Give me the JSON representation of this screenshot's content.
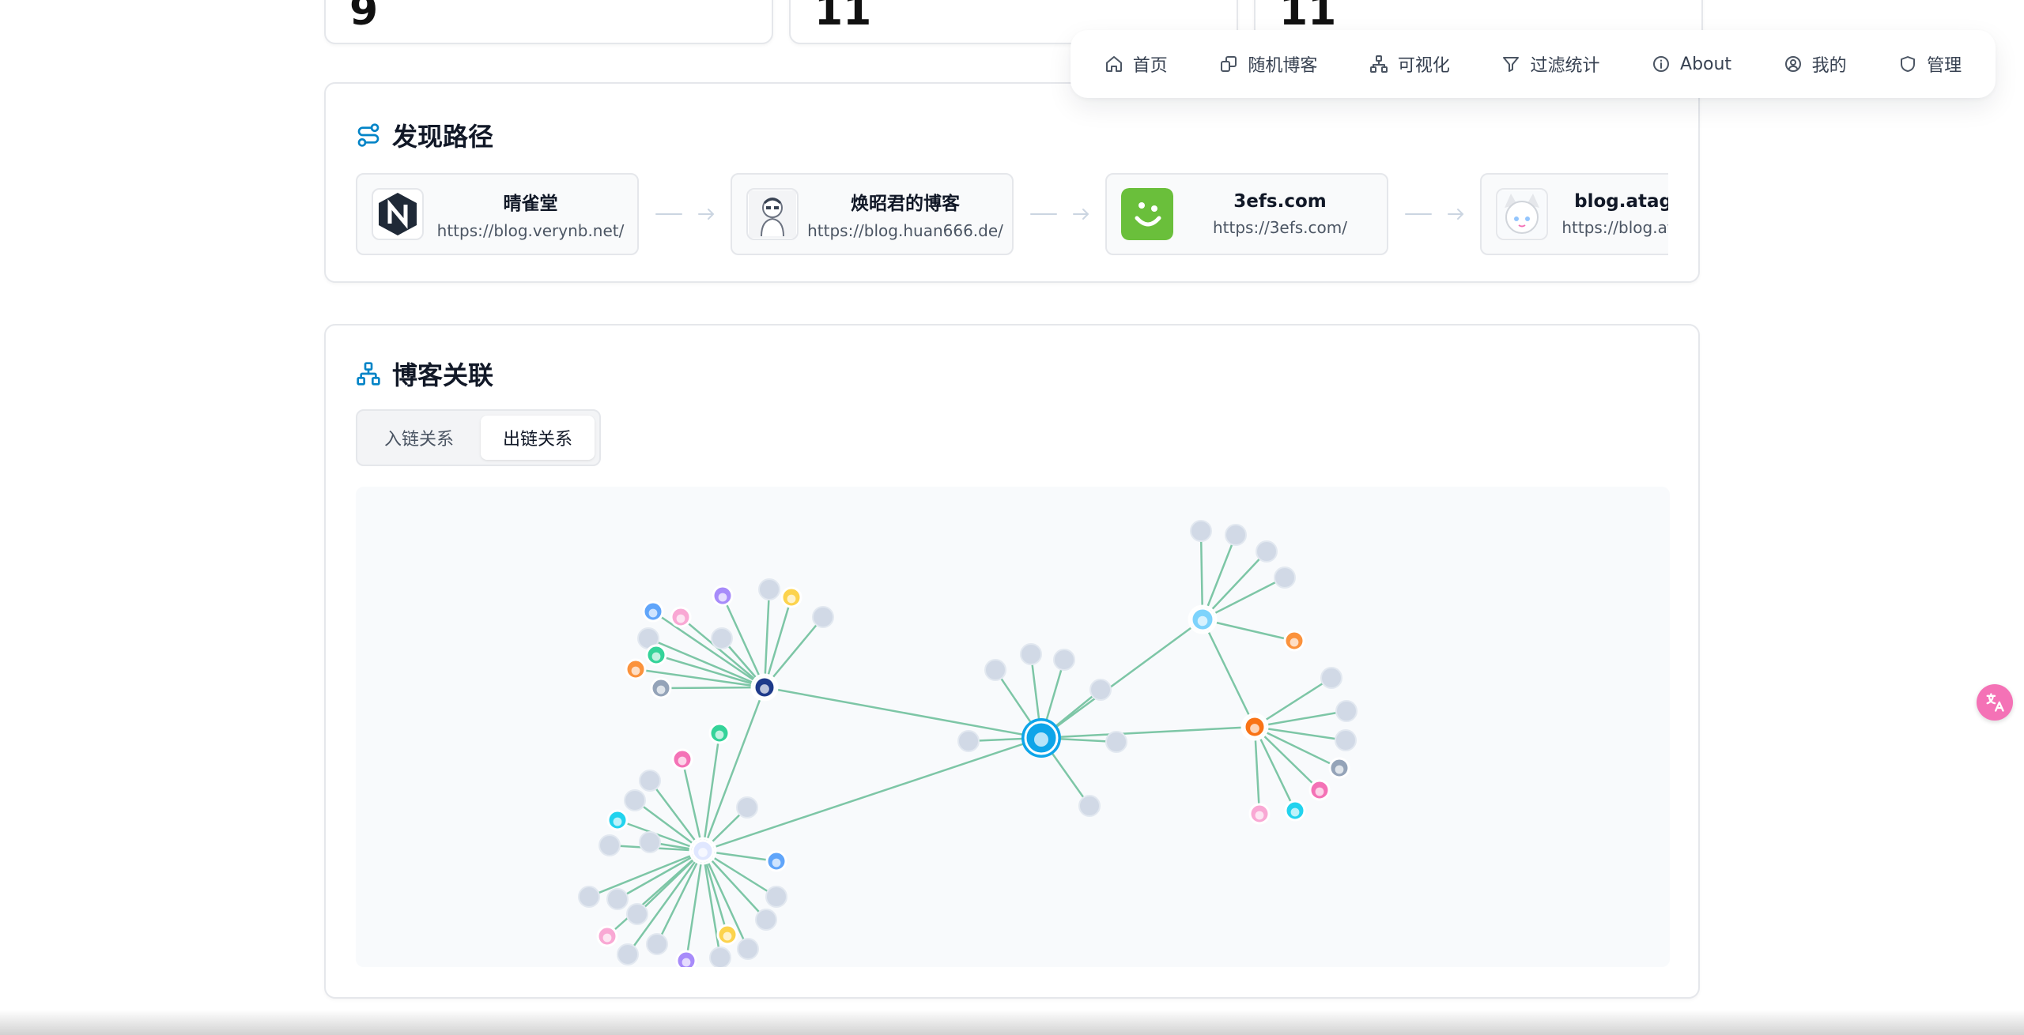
{
  "stats": [
    {
      "value": "9"
    },
    {
      "value": "11"
    },
    {
      "value": "11"
    }
  ],
  "nav": {
    "items": [
      {
        "label": "首页",
        "icon": "home-icon"
      },
      {
        "label": "随机博客",
        "icon": "shuffle-icon"
      },
      {
        "label": "可视化",
        "icon": "network-icon"
      },
      {
        "label": "过滤统计",
        "icon": "filter-icon"
      },
      {
        "label": "About",
        "icon": "info-icon"
      },
      {
        "label": "我的",
        "icon": "user-circle-icon"
      },
      {
        "label": "管理",
        "icon": "shield-icon"
      }
    ]
  },
  "discovery": {
    "title": "发现路径",
    "nodes": [
      {
        "name": "晴雀堂",
        "url": "https://blog.verynb.net/"
      },
      {
        "name": "焕昭君的博客",
        "url": "https://blog.huan666.de/"
      },
      {
        "name": "3efs.com",
        "url": "https://3efs.com/"
      },
      {
        "name": "blog.atago.moe",
        "url": "https://blog.atago.moe/"
      }
    ]
  },
  "relations": {
    "title": "博客关联",
    "tabs": [
      {
        "label": "入链关系",
        "active": false
      },
      {
        "label": "出链关系",
        "active": true
      }
    ]
  },
  "colors": {
    "accent": "#0284c7",
    "edge": "#7dc6a6",
    "node": "#d1d9e6",
    "fab": "#f472b6"
  }
}
